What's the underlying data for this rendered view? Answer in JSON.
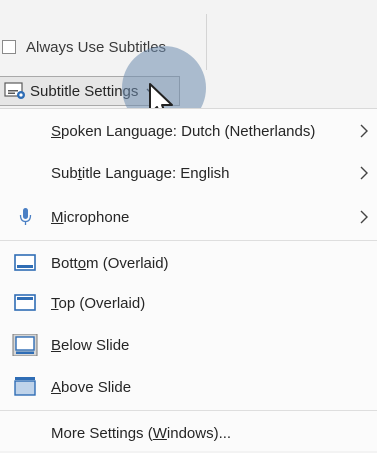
{
  "ribbon": {
    "always_use_subtitles": {
      "label": "Always Use Subtitles",
      "checked": false
    },
    "subtitle_settings_button": {
      "label": "Subtitle Settings"
    }
  },
  "menu": {
    "spoken_language": {
      "label_pre": "",
      "label_ul": "S",
      "label_post": "poken Language: Dutch (Netherlands)"
    },
    "subtitle_language": {
      "label_pre": "Sub",
      "label_ul": "t",
      "label_post": "itle Language: English"
    },
    "microphone": {
      "label_pre": "",
      "label_ul": "M",
      "label_post": "icrophone"
    },
    "bottom_overlaid": {
      "label_pre": "Bott",
      "label_ul": "o",
      "label_post": "m (Overlaid)"
    },
    "top_overlaid": {
      "label_pre": "",
      "label_ul": "T",
      "label_post": "op (Overlaid)"
    },
    "below_slide": {
      "label_pre": "",
      "label_ul": "B",
      "label_post": "elow Slide"
    },
    "above_slide": {
      "label_pre": "",
      "label_ul": "A",
      "label_post": "bove Slide"
    },
    "more_settings": {
      "label_pre": "More Settings (",
      "label_ul": "W",
      "label_post": "indows)..."
    }
  },
  "colors": {
    "icon_blue": "#2f6db5",
    "icon_fill": "#bfd3ea",
    "halo": "#6e8caf"
  }
}
